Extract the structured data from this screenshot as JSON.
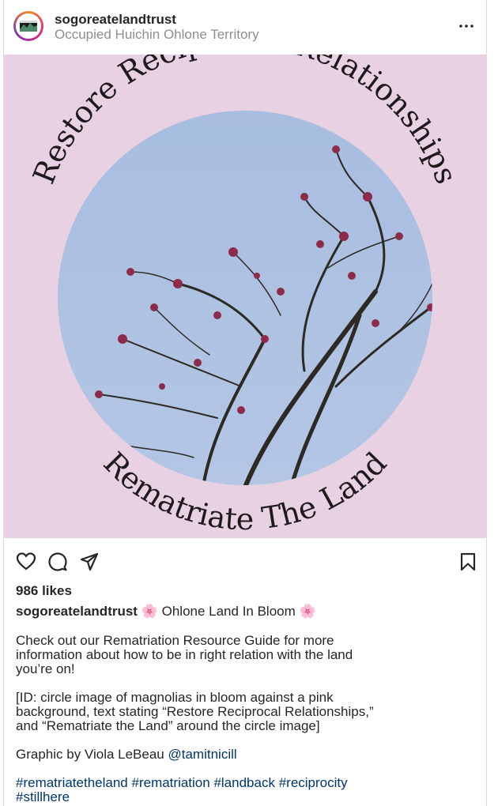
{
  "post": {
    "username": "sogoreatelandtrust",
    "location": "Occupied Huichin Ohlone Territory",
    "image": {
      "arc_top_text": "Restore Reciprocal Relationships",
      "arc_bottom_text": "Rematriate The Land",
      "background_color": "#e8d1e2",
      "sky_color": "#a9bfe0"
    },
    "likes": "986 likes",
    "caption_title": "🌸 Ohlone Land In Bloom 🌸",
    "paragraphs": {
      "p1_l1": "Check out our Rematriation Resource Guide for more",
      "p1_l2": "information about how to be in right relation with the land",
      "p1_l3": "you’re on!",
      "p2_l1": "[ID: circle image of magnolias in bloom against a pink",
      "p2_l2": "background, text stating “Restore Reciprocal Relationships,”",
      "p2_l3": "and “Rematriate the Land” around the circle image]",
      "credit_prefix": "Graphic by Viola LeBeau",
      "credit_handle": "@tamitnicill"
    },
    "hashtags": [
      "#rematriatetheland",
      "#rematriation",
      "#landback",
      "#reciprocity",
      "#stillhere"
    ]
  }
}
